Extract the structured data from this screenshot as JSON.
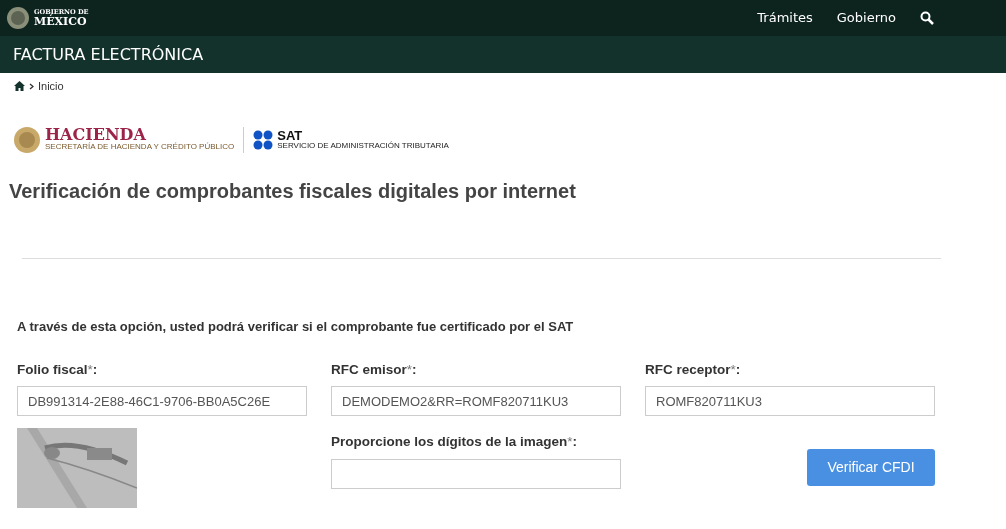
{
  "top_bar": {
    "brand_line_1": "GOBIERNO DE",
    "brand_line_2": "MÉXICO",
    "links": [
      "Trámites",
      "Gobierno"
    ]
  },
  "section_bar": {
    "title": "FACTURA ELECTRÓNICA"
  },
  "breadcrumb": [
    "Inicio"
  ],
  "logos": {
    "hacienda": "HACIENDA",
    "hacienda_sub": "SECRETARÍA DE HACIENDA Y CRÉDITO PÚBLICO",
    "sat": "SAT",
    "sat_sub": "SERVICIO DE ADMINISTRACIÓN TRIBUTARIA"
  },
  "page_title": "Verificación de comprobantes fiscales digitales por internet",
  "intro": "A través de esta opción, usted podrá verificar si el comprobante fue certificado por el SAT",
  "fields": [
    {
      "label": "Folio fiscal",
      "required": "*",
      "suffix": ":",
      "value": "DB991314-2E88-46C1-9706-BB0A5C26E"
    },
    {
      "label": "RFC emisor",
      "required": "*",
      "suffix": ":",
      "value": "DEMODEMO2&RR=ROMF820711KU3"
    },
    {
      "label": "RFC receptor",
      "required": "*",
      "suffix": ":",
      "value": "ROMF820711KU3"
    }
  ],
  "captcha": {
    "kind": "picture",
    "label": "Proporcione los dígitos de la imagen",
    "required": "*",
    "suffix": ":"
  },
  "submit": "Verificar CFDI"
}
